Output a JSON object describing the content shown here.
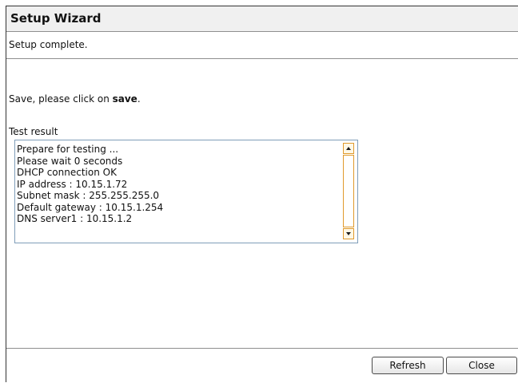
{
  "window": {
    "title": "Setup Wizard"
  },
  "status": {
    "text": "Setup complete."
  },
  "instructions": {
    "prefix": "Save, please click on ",
    "save_word": "save",
    "suffix": "."
  },
  "test_result": {
    "label": "Test result",
    "lines": [
      "Prepare for testing ...",
      "Please wait 0 seconds",
      "DHCP connection OK",
      "IP address : 10.15.1.72",
      "Subnet mask : 255.255.255.0",
      "Default gateway  : 10.15.1.254",
      "DNS server1 : 10.15.1.2"
    ]
  },
  "footer": {
    "refresh_label": "Refresh",
    "close_label": "Close"
  },
  "colors": {
    "scroll_accent": "#e09a2c",
    "field_border": "#7f9db9"
  }
}
